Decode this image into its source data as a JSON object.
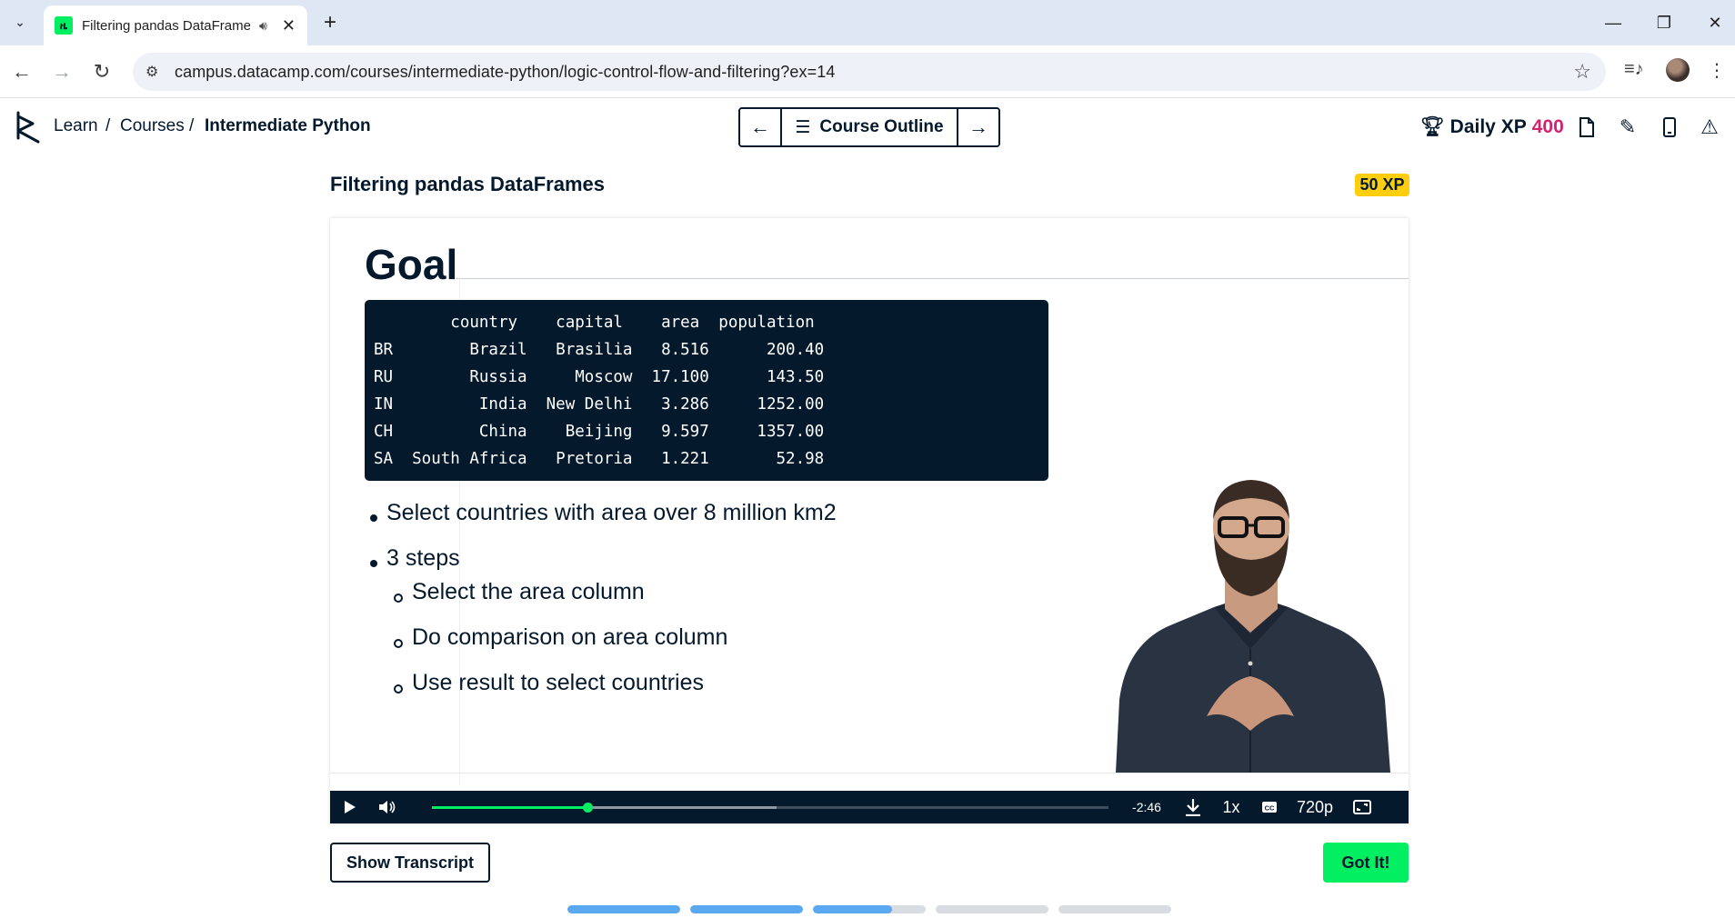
{
  "browser": {
    "tab_title": "Filtering pandas DataFrames",
    "url": "campus.datacamp.com/courses/intermediate-python/logic-control-flow-and-filtering?ex=14",
    "new_tab_symbol": "+",
    "tab_close_symbol": "✕"
  },
  "header": {
    "breadcrumb": [
      "Learn",
      "Courses",
      "Intermediate Python"
    ],
    "breadcrumb_sep": "/",
    "course_outline_label": "Course Outline",
    "daily_xp_label": "Daily XP",
    "daily_xp_value": "400"
  },
  "exercise": {
    "title": "Filtering pandas DataFrames",
    "xp_badge": "50 XP"
  },
  "slide": {
    "title": "Goal",
    "table_text": "        country    capital    area  population\nBR        Brazil   Brasilia   8.516      200.40\nRU        Russia     Moscow  17.100      143.50\nIN         India  New Delhi   3.286     1252.00\nCH         China    Beijing   9.597     1357.00\nSA  South Africa   Pretoria   1.221       52.98",
    "bullets": [
      "Select countries with area over 8 million km2",
      "3 steps"
    ],
    "sub_bullets": [
      "Select the area column",
      "Do comparison on area column",
      "Use result to select countries"
    ]
  },
  "player": {
    "time_remaining": "-2:46",
    "speed": "1x",
    "quality": "720p",
    "played_fraction": 0.23,
    "buffered_fraction": 0.51
  },
  "actions": {
    "show_transcript": "Show Transcript",
    "got_it": "Got It!"
  },
  "lesson_progress": [
    1.0,
    1.0,
    0.7,
    0.0,
    0.0
  ],
  "colors": {
    "brand_green": "#03ef62",
    "navy": "#05192d",
    "xp_pink": "#d0246f",
    "xp_badge_yellow": "#fcce0d",
    "progress_blue": "#5aa8f0"
  }
}
